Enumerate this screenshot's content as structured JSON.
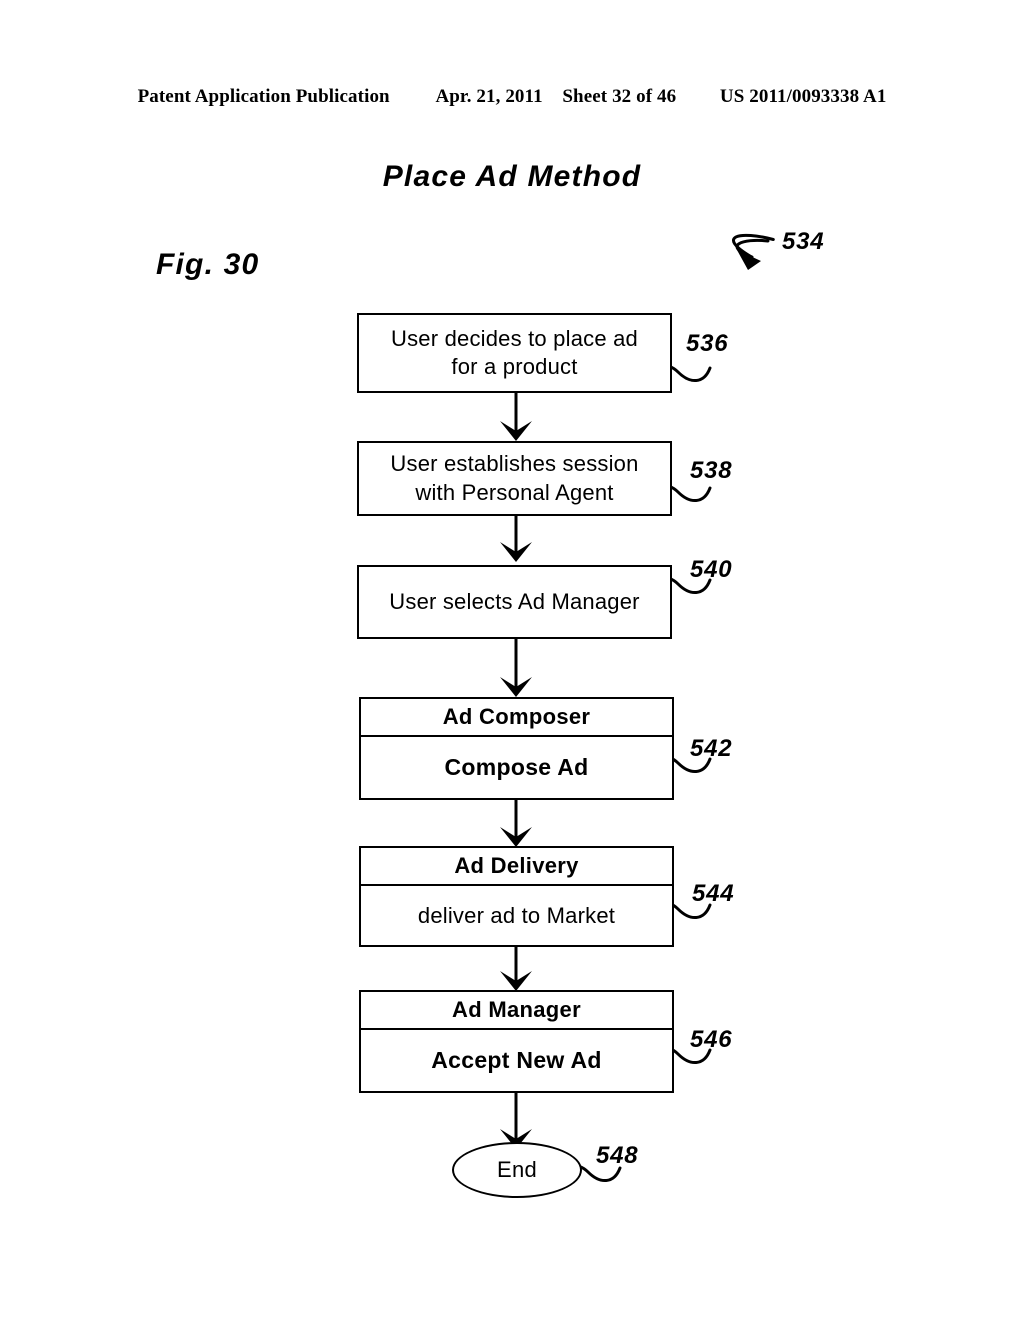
{
  "header": {
    "publication": "Patent Application Publication",
    "date": "Apr. 21, 2011",
    "sheet": "Sheet 32 of 46",
    "number": "US 2011/0093338 A1"
  },
  "figure": {
    "title": "Place Ad Method",
    "label": "Fig. 30",
    "diagram_ref": "534"
  },
  "flowchart": {
    "nodes": [
      {
        "id": "decide",
        "kind": "process",
        "line1": "User decides to place ad",
        "line2": "for a product",
        "ref": "536"
      },
      {
        "id": "session",
        "kind": "process",
        "line1": "User establishes session",
        "line2": "with Personal Agent",
        "ref": "538"
      },
      {
        "id": "select",
        "kind": "process",
        "line1": "User selects Ad Manager",
        "ref": "540"
      },
      {
        "id": "composer",
        "kind": "split",
        "header": "Ad Composer",
        "body": "Compose Ad",
        "ref": "542"
      },
      {
        "id": "delivery",
        "kind": "split",
        "header": "Ad Delivery",
        "body": "deliver ad to Market",
        "ref": "544"
      },
      {
        "id": "manager",
        "kind": "split",
        "header": "Ad Manager",
        "body": "Accept New Ad",
        "ref": "546"
      },
      {
        "id": "end",
        "kind": "terminator",
        "line1": "End",
        "ref": "548"
      }
    ],
    "edges": [
      {
        "from": "decide",
        "to": "session"
      },
      {
        "from": "session",
        "to": "select"
      },
      {
        "from": "select",
        "to": "composer"
      },
      {
        "from": "composer",
        "to": "delivery"
      },
      {
        "from": "delivery",
        "to": "manager"
      },
      {
        "from": "manager",
        "to": "end"
      }
    ],
    "line_color": "#000000",
    "background": "#ffffff"
  }
}
